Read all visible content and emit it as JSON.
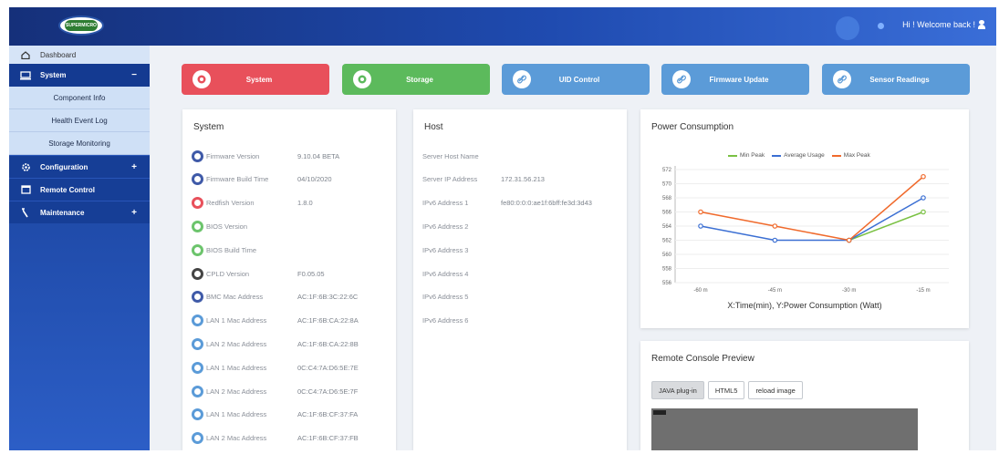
{
  "header": {
    "logo_text": "SUPERMICRO",
    "welcome": "Hi ! Welcome back !"
  },
  "sidebar": {
    "items": [
      {
        "label": "Dashboard",
        "icon": "home-icon"
      },
      {
        "label": "System",
        "icon": "monitor-icon",
        "expander": "−"
      },
      {
        "label": "Configuration",
        "icon": "gear-icon",
        "expander": "+"
      },
      {
        "label": "Remote Control",
        "icon": "screen-icon"
      },
      {
        "label": "Maintenance",
        "icon": "wrench-icon",
        "expander": "+"
      }
    ],
    "system_sub": [
      "Component Info",
      "Health Event Log",
      "Storage Monitoring"
    ]
  },
  "tiles": [
    {
      "label": "System",
      "color": "#e8505b",
      "icon": "system-icon"
    },
    {
      "label": "Storage",
      "color": "#5cba5c",
      "icon": "storage-icon"
    },
    {
      "label": "UID Control",
      "color": "#5b9bd8",
      "icon": "link-icon"
    },
    {
      "label": "Firmware Update",
      "color": "#5b9bd8",
      "icon": "link-icon"
    },
    {
      "label": "Sensor Readings",
      "color": "#5b9bd8",
      "icon": "link-icon"
    }
  ],
  "system_card": {
    "title": "System",
    "rows": [
      {
        "label": "Firmware Version",
        "value": "9.10.04 BETA",
        "color": "#3f5aa8"
      },
      {
        "label": "Firmware Build Time",
        "value": "04/10/2020",
        "color": "#3f5aa8"
      },
      {
        "label": "Redfish Version",
        "value": "1.8.0",
        "color": "#e8505b"
      },
      {
        "label": "BIOS Version",
        "value": "",
        "color": "#6cc46c"
      },
      {
        "label": "BIOS Build Time",
        "value": "",
        "color": "#6cc46c"
      },
      {
        "label": "CPLD Version",
        "value": "F0.05.05",
        "color": "#444444"
      },
      {
        "label": "BMC Mac Address",
        "value": "AC:1F:6B:3C:22:6C",
        "color": "#3f5aa8"
      },
      {
        "label": "LAN 1 Mac Address",
        "value": "AC:1F:6B:CA:22:8A",
        "color": "#5b9bd8"
      },
      {
        "label": "LAN 2 Mac Address",
        "value": "AC:1F:6B:CA:22:8B",
        "color": "#5b9bd8"
      },
      {
        "label": "LAN 1 Mac Address",
        "value": "0C:C4:7A:D6:5E:7E",
        "color": "#5b9bd8"
      },
      {
        "label": "LAN 2 Mac Address",
        "value": "0C:C4:7A:D6:5E:7F",
        "color": "#5b9bd8"
      },
      {
        "label": "LAN 1 Mac Address",
        "value": "AC:1F:6B:CF:37:FA",
        "color": "#5b9bd8"
      },
      {
        "label": "LAN 2 Mac Address",
        "value": "AC:1F:6B:CF:37:FB",
        "color": "#5b9bd8"
      }
    ]
  },
  "host_card": {
    "title": "Host",
    "rows": [
      {
        "label": "Server Host Name",
        "value": ""
      },
      {
        "label": "Server IP Address",
        "value": "172.31.56.213"
      },
      {
        "label": "IPv6 Address 1",
        "value": "fe80:0:0:0:ae1f:6bff:fe3d:3d43"
      },
      {
        "label": "IPv6 Address 2",
        "value": ""
      },
      {
        "label": "IPv6 Address 3",
        "value": ""
      },
      {
        "label": "IPv6 Address 4",
        "value": ""
      },
      {
        "label": "IPv6 Address 5",
        "value": ""
      },
      {
        "label": "IPv6 Address 6",
        "value": ""
      }
    ]
  },
  "power_card": {
    "title": "Power Consumption",
    "caption": "X:Time(min), Y:Power Consumption (Watt)"
  },
  "chart_data": {
    "type": "line",
    "title": "",
    "categories": [
      "-60 m",
      "-45 m",
      "-30 m",
      "-15 m"
    ],
    "series": [
      {
        "name": "Min Peak",
        "color": "#7ac143",
        "values": [
          null,
          null,
          562,
          566
        ]
      },
      {
        "name": "Average Usage",
        "color": "#3b6fd3",
        "values": [
          564,
          562,
          562,
          568
        ]
      },
      {
        "name": "Max Peak",
        "color": "#f06a2c",
        "values": [
          566,
          564,
          562,
          571
        ]
      }
    ],
    "yticks": [
      556,
      558,
      560,
      562,
      564,
      566,
      568,
      570,
      572
    ],
    "ylim": [
      556,
      572
    ],
    "legend": "top"
  },
  "console_card": {
    "title": "Remote Console Preview",
    "buttons": [
      "JAVA plug-in",
      "HTML5",
      "reload image"
    ]
  }
}
